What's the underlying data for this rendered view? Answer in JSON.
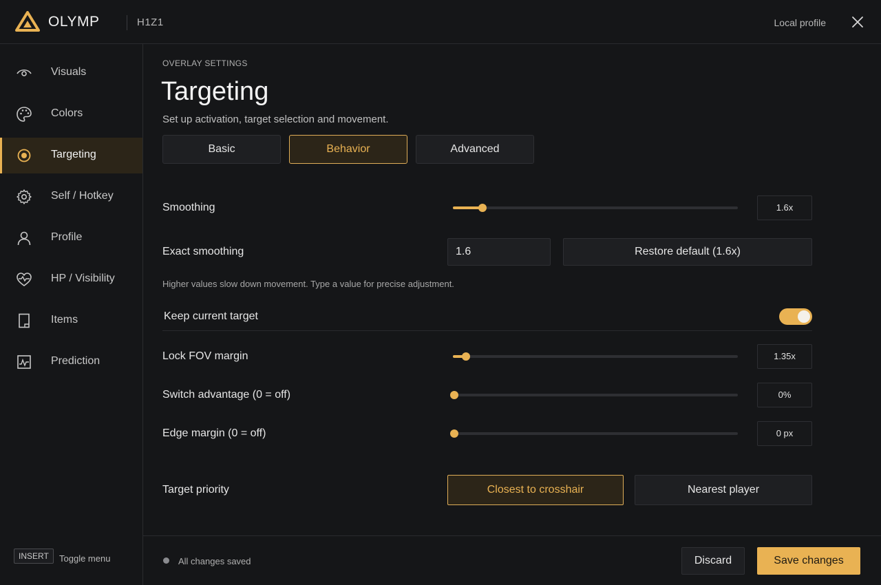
{
  "header": {
    "brand": "OLYMP",
    "game": "H1Z1",
    "profile": "Local profile",
    "logo_icon": "olymp-logo",
    "close_icon": "close-icon"
  },
  "sidebar": {
    "items": [
      {
        "label": "Visuals",
        "icon": "eye-icon"
      },
      {
        "label": "Colors",
        "icon": "palette-icon"
      },
      {
        "label": "Targeting",
        "icon": "target-icon",
        "active": true
      },
      {
        "label": "Self / Hotkey",
        "icon": "gear-icon"
      },
      {
        "label": "Profile",
        "icon": "user-icon"
      },
      {
        "label": "HP / Visibility",
        "icon": "heart-pulse-icon"
      },
      {
        "label": "Items",
        "icon": "bookmark-icon"
      },
      {
        "label": "Prediction",
        "icon": "chart-icon"
      }
    ],
    "shortcut_key": "INSERT",
    "shortcut_label": "Toggle menu"
  },
  "main": {
    "section": "OVERLAY SETTINGS",
    "title": "Targeting",
    "subtitle": "Set up activation, target selection and movement.",
    "tabs": [
      {
        "label": "Basic",
        "active": false
      },
      {
        "label": "Behavior",
        "active": true
      },
      {
        "label": "Advanced",
        "active": false
      }
    ],
    "smoothing": {
      "label": "Smoothing",
      "value": "1.6x",
      "level": 0.1
    },
    "exact_smoothing": {
      "label": "Exact smoothing",
      "value": "1.6",
      "restore_label": "Restore default (1.6x)"
    },
    "hint": "Higher values slow down movement. Type a value for precise adjustment.",
    "keep_target": {
      "label": "Keep current target",
      "enabled": true
    },
    "lock_fov": {
      "label": "Lock FOV margin",
      "value": "1.35x",
      "level": 0.04
    },
    "switch_advantage": {
      "label": "Switch advantage (0 = off)",
      "value": "0%",
      "level": 0
    },
    "edge_margin": {
      "label": "Edge margin (0 = off)",
      "value": "0 px",
      "level": 0
    },
    "target_priority": {
      "label": "Target priority",
      "options": [
        {
          "label": "Closest to crosshair",
          "active": true
        },
        {
          "label": "Nearest player",
          "active": false
        }
      ]
    }
  },
  "footer": {
    "status": "All changes saved",
    "discard_label": "Discard",
    "save_label": "Save changes"
  },
  "colors": {
    "accent": "#e9b253",
    "background": "#151618",
    "panel": "#1e1f22"
  }
}
